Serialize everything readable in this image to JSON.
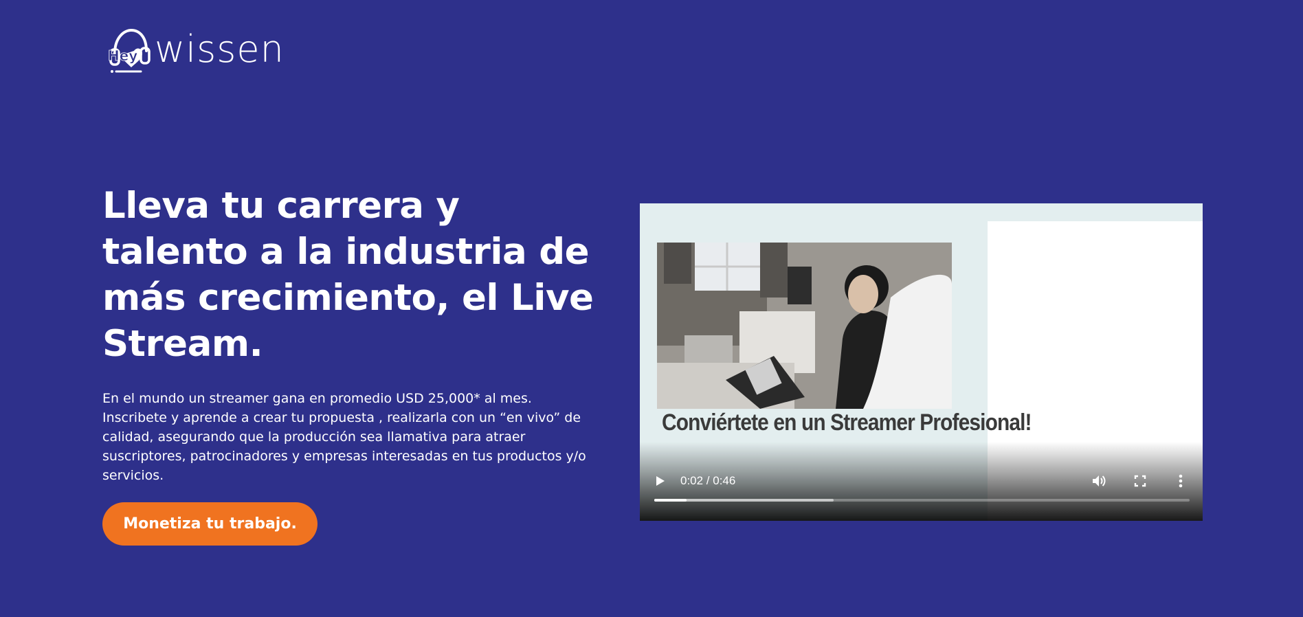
{
  "brand": {
    "logo_prefix": "Hey",
    "logo_word": "wissen"
  },
  "hero": {
    "title": "Lleva tu carrera y talento a la industria de más crecimiento, el Live Stream.",
    "description": "En el mundo un streamer gana en promedio USD 25,000* al mes. Inscribete y aprende a crear tu propuesta , realizarla con un “en vivo” de calidad, asegurando que la producción sea llamativa para atraer suscriptores, patrocinadores y empresas interesadas en tus productos y/o servicios.",
    "cta_label": "Monetiza tu trabajo."
  },
  "video": {
    "headline": "Conviértete en un Streamer Profesional!",
    "time_display": "0:02 / 0:46",
    "played_fraction": 0.06,
    "buffered_fraction": 0.335,
    "icons": {
      "play": "play-icon",
      "volume": "volume-icon",
      "fullscreen": "fullscreen-icon",
      "more": "more-vert-icon"
    }
  },
  "colors": {
    "background": "#2e308b",
    "cta": "#f07320",
    "text": "#ffffff"
  }
}
